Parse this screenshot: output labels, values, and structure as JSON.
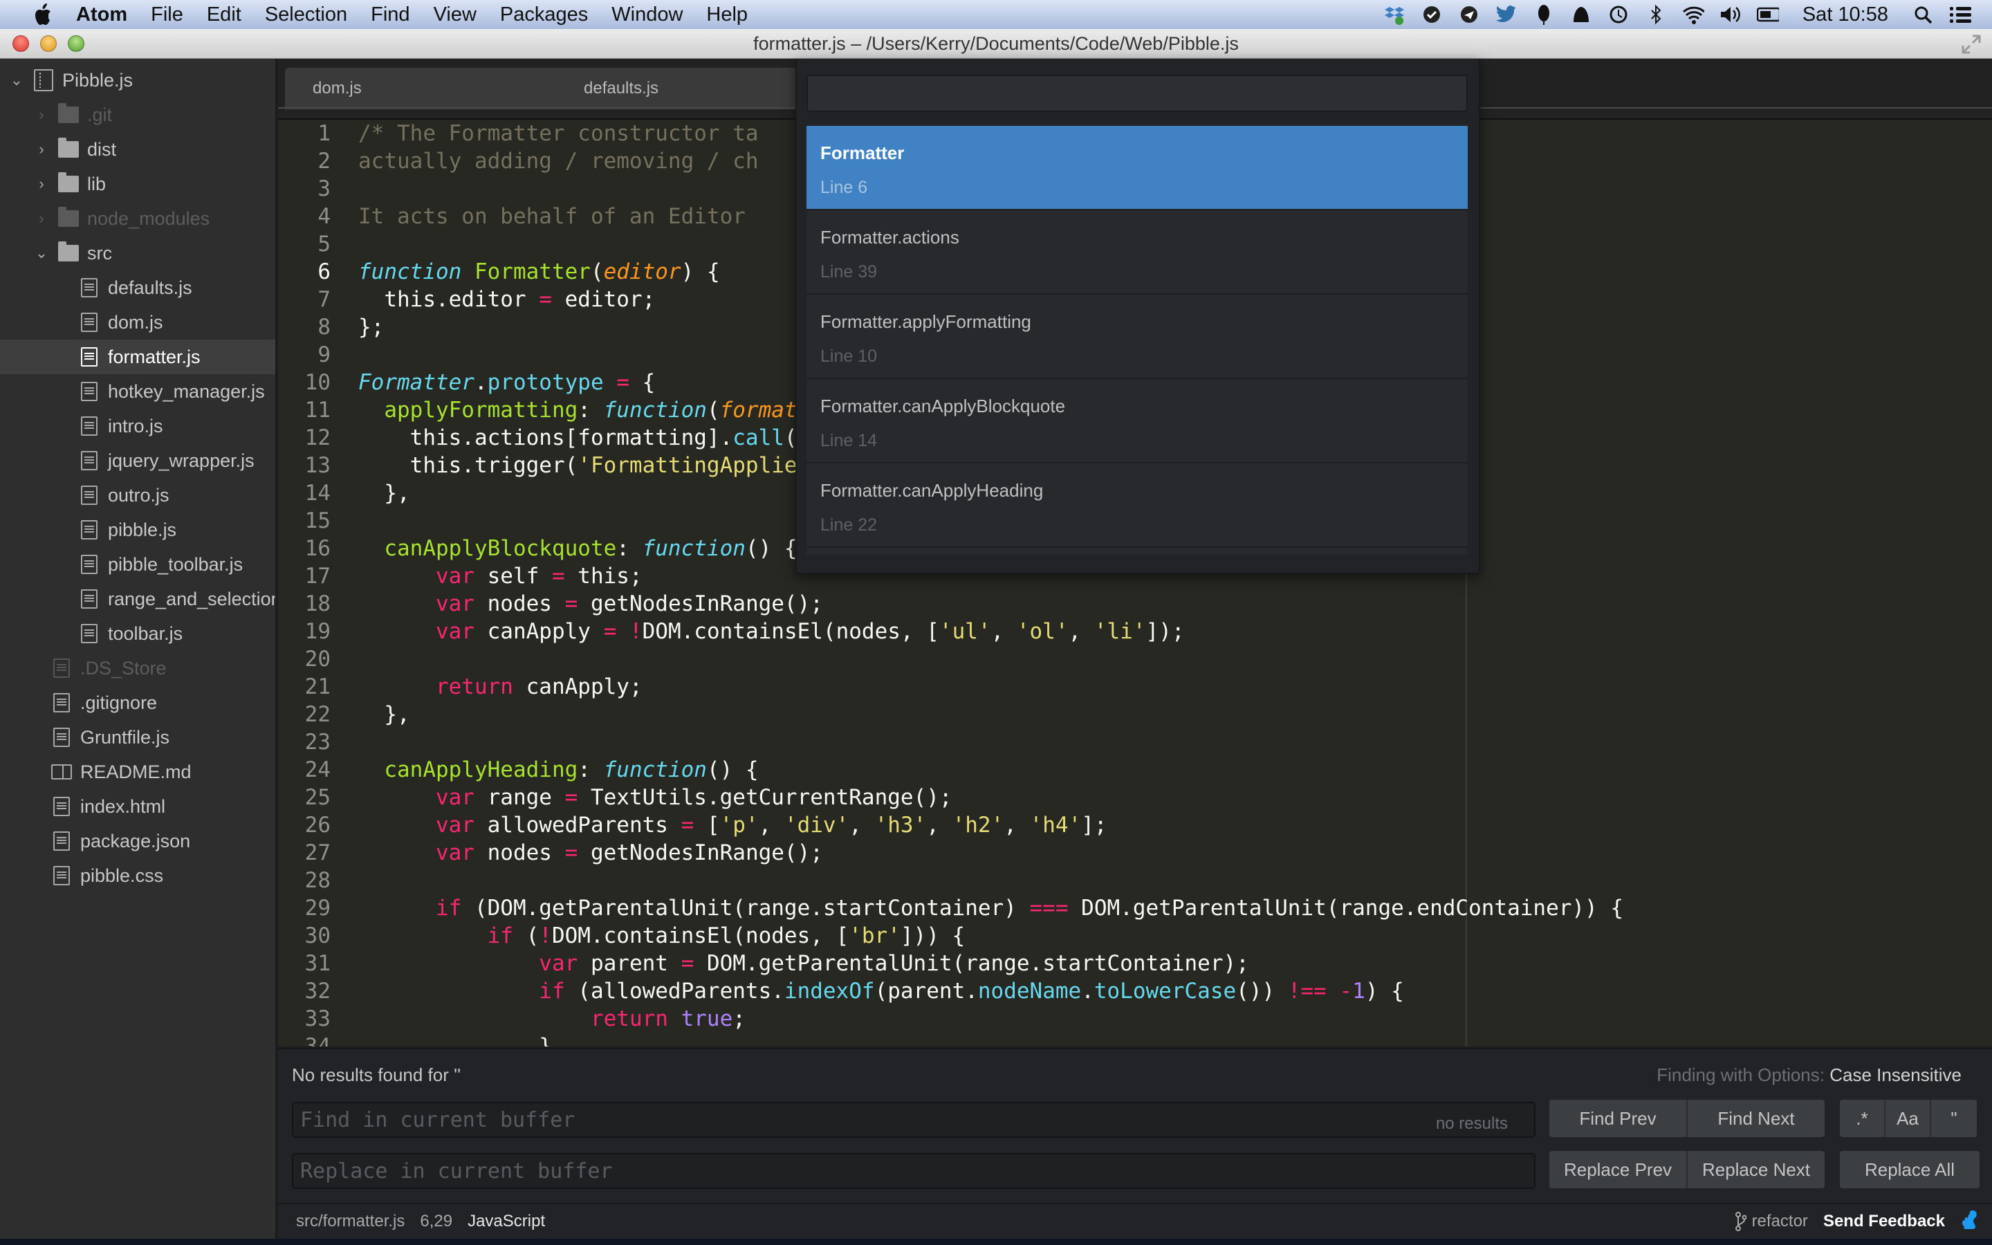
{
  "menubar": {
    "app_name": "Atom",
    "items": [
      "File",
      "Edit",
      "Selection",
      "Find",
      "View",
      "Packages",
      "Window",
      "Help"
    ],
    "tray_icons": [
      "dropbox-icon",
      "skype-icon",
      "airmail-icon",
      "twitter-icon",
      "evernote-icon",
      "growl-icon",
      "time-machine-icon",
      "bluetooth-icon",
      "wifi-icon",
      "volume-icon",
      "battery-icon"
    ],
    "clock": "Sat 10:58"
  },
  "window": {
    "title": "formatter.js – /Users/Kerry/Documents/Code/Web/Pibble.js"
  },
  "tree": {
    "project": "Pibble.js",
    "rows": [
      {
        "label": ".git",
        "type": "folder",
        "depth": 1,
        "expanded": false,
        "ignored": true
      },
      {
        "label": "dist",
        "type": "folder",
        "depth": 1,
        "expanded": false,
        "ignored": false
      },
      {
        "label": "lib",
        "type": "folder",
        "depth": 1,
        "expanded": false,
        "ignored": false
      },
      {
        "label": "node_modules",
        "type": "folder",
        "depth": 1,
        "expanded": false,
        "ignored": true
      },
      {
        "label": "src",
        "type": "folder",
        "depth": 1,
        "expanded": true,
        "ignored": false
      },
      {
        "label": "defaults.js",
        "type": "file",
        "depth": 2
      },
      {
        "label": "dom.js",
        "type": "file",
        "depth": 2
      },
      {
        "label": "formatter.js",
        "type": "file",
        "depth": 2,
        "selected": true
      },
      {
        "label": "hotkey_manager.js",
        "type": "file",
        "depth": 2
      },
      {
        "label": "intro.js",
        "type": "file",
        "depth": 2
      },
      {
        "label": "jquery_wrapper.js",
        "type": "file",
        "depth": 2
      },
      {
        "label": "outro.js",
        "type": "file",
        "depth": 2
      },
      {
        "label": "pibble.js",
        "type": "file",
        "depth": 2
      },
      {
        "label": "pibble_toolbar.js",
        "type": "file",
        "depth": 2
      },
      {
        "label": "range_and_selection",
        "type": "file",
        "depth": 2
      },
      {
        "label": "toolbar.js",
        "type": "file",
        "depth": 2
      },
      {
        "label": ".DS_Store",
        "type": "file",
        "depth": 1,
        "ignored": true
      },
      {
        "label": ".gitignore",
        "type": "file",
        "depth": 1
      },
      {
        "label": "Gruntfile.js",
        "type": "file",
        "depth": 1
      },
      {
        "label": "README.md",
        "type": "readme",
        "depth": 1
      },
      {
        "label": "index.html",
        "type": "file",
        "depth": 1
      },
      {
        "label": "package.json",
        "type": "file",
        "depth": 1
      },
      {
        "label": "pibble.css",
        "type": "file",
        "depth": 1
      }
    ]
  },
  "tabs": [
    {
      "label": "dom.js",
      "close": "×"
    },
    {
      "label": "defaults.js"
    }
  ],
  "editor": {
    "active_line": 6,
    "lines": [
      [
        [
          "cm",
          "/* The Formatter constructor ta"
        ]
      ],
      [
        [
          "cm",
          "actually adding / removing / ch"
        ]
      ],
      [],
      [
        [
          "cm",
          "It acts on behalf of an Editor "
        ]
      ],
      [],
      [
        [
          "sf",
          "function"
        ],
        [
          "",
          " "
        ],
        [
          "fn",
          "Formatter"
        ],
        [
          "",
          "("
        ],
        [
          "ar",
          "editor"
        ],
        [
          "",
          ") {"
        ]
      ],
      [
        [
          "",
          "  this.editor "
        ],
        [
          "kw",
          "="
        ],
        [
          "",
          " editor;"
        ]
      ],
      [
        [
          "",
          "};"
        ]
      ],
      [],
      [
        [
          "sf",
          "Formatter"
        ],
        [
          "",
          "."
        ],
        [
          "sp",
          "prototype"
        ],
        [
          "",
          " "
        ],
        [
          "kw",
          "="
        ],
        [
          "",
          " {"
        ]
      ],
      [
        [
          "",
          "  "
        ],
        [
          "fn",
          "applyFormatting"
        ],
        [
          "",
          ": "
        ],
        [
          "sf",
          "function"
        ],
        [
          "",
          "("
        ],
        [
          "ar",
          "formatting"
        ],
        [
          "",
          ") {"
        ]
      ],
      [
        [
          "",
          "    this.actions[formatting]."
        ],
        [
          "sp",
          "call"
        ],
        [
          "",
          "(this);"
        ]
      ],
      [
        [
          "",
          "    this.trigger("
        ],
        [
          "st",
          "'FormattingApplied'"
        ],
        [
          "",
          ");"
        ]
      ],
      [
        [
          "",
          "  },"
        ]
      ],
      [],
      [
        [
          "",
          "  "
        ],
        [
          "fn",
          "canApplyBlockquote"
        ],
        [
          "",
          ": "
        ],
        [
          "sf",
          "function"
        ],
        [
          "",
          "() {"
        ]
      ],
      [
        [
          "",
          "      "
        ],
        [
          "kw",
          "var"
        ],
        [
          "",
          " self "
        ],
        [
          "kw",
          "="
        ],
        [
          "",
          " this;"
        ]
      ],
      [
        [
          "",
          "      "
        ],
        [
          "kw",
          "var"
        ],
        [
          "",
          " nodes "
        ],
        [
          "kw",
          "="
        ],
        [
          "",
          " getNodesInRange();"
        ]
      ],
      [
        [
          "",
          "      "
        ],
        [
          "kw",
          "var"
        ],
        [
          "",
          " canApply "
        ],
        [
          "kw",
          "="
        ],
        [
          "",
          " "
        ],
        [
          "kw",
          "!"
        ],
        [
          "",
          "DOM.containsEl(nodes, ["
        ],
        [
          "st",
          "'ul'"
        ],
        [
          "",
          ", "
        ],
        [
          "st",
          "'ol'"
        ],
        [
          "",
          ", "
        ],
        [
          "st",
          "'li'"
        ],
        [
          "",
          "]);"
        ]
      ],
      [],
      [
        [
          "",
          "      "
        ],
        [
          "kw",
          "return"
        ],
        [
          "",
          " canApply;"
        ]
      ],
      [
        [
          "",
          "  },"
        ]
      ],
      [],
      [
        [
          "",
          "  "
        ],
        [
          "fn",
          "canApplyHeading"
        ],
        [
          "",
          ": "
        ],
        [
          "sf",
          "function"
        ],
        [
          "",
          "() {"
        ]
      ],
      [
        [
          "",
          "      "
        ],
        [
          "kw",
          "var"
        ],
        [
          "",
          " range "
        ],
        [
          "kw",
          "="
        ],
        [
          "",
          " TextUtils.getCurrentRange();"
        ]
      ],
      [
        [
          "",
          "      "
        ],
        [
          "kw",
          "var"
        ],
        [
          "",
          " allowedParents "
        ],
        [
          "kw",
          "="
        ],
        [
          "",
          " ["
        ],
        [
          "st",
          "'p'"
        ],
        [
          "",
          ", "
        ],
        [
          "st",
          "'div'"
        ],
        [
          "",
          ", "
        ],
        [
          "st",
          "'h3'"
        ],
        [
          "",
          ", "
        ],
        [
          "st",
          "'h2'"
        ],
        [
          "",
          ", "
        ],
        [
          "st",
          "'h4'"
        ],
        [
          "",
          "];"
        ]
      ],
      [
        [
          "",
          "      "
        ],
        [
          "kw",
          "var"
        ],
        [
          "",
          " nodes "
        ],
        [
          "kw",
          "="
        ],
        [
          "",
          " getNodesInRange();"
        ]
      ],
      [],
      [
        [
          "",
          "      "
        ],
        [
          "kw",
          "if"
        ],
        [
          "",
          " (DOM.getParentalUnit(range.startContainer) "
        ],
        [
          "kw",
          "==="
        ],
        [
          "",
          " DOM.getParentalUnit(range.endContainer)) {"
        ]
      ],
      [
        [
          "",
          "          "
        ],
        [
          "kw",
          "if"
        ],
        [
          "",
          " ("
        ],
        [
          "kw",
          "!"
        ],
        [
          "",
          "DOM.containsEl(nodes, ["
        ],
        [
          "st",
          "'br'"
        ],
        [
          "",
          "])) {"
        ]
      ],
      [
        [
          "",
          "              "
        ],
        [
          "kw",
          "var"
        ],
        [
          "",
          " parent "
        ],
        [
          "kw",
          "="
        ],
        [
          "",
          " DOM.getParentalUnit(range.startContainer);"
        ]
      ],
      [
        [
          "",
          "              "
        ],
        [
          "kw",
          "if"
        ],
        [
          "",
          " (allowedParents."
        ],
        [
          "sp",
          "indexOf"
        ],
        [
          "",
          "(parent."
        ],
        [
          "sp",
          "nodeName"
        ],
        [
          "",
          "."
        ],
        [
          "sp",
          "toLowerCase"
        ],
        [
          "",
          "()) "
        ],
        [
          "kw",
          "!=="
        ],
        [
          "",
          " "
        ],
        [
          "kw",
          "-"
        ],
        [
          "nu",
          "1"
        ],
        [
          "",
          ") {"
        ]
      ],
      [
        [
          "",
          "                  "
        ],
        [
          "kw",
          "return"
        ],
        [
          "",
          " "
        ],
        [
          "nu",
          "true"
        ],
        [
          "",
          ";"
        ]
      ],
      [
        [
          "",
          "              }"
        ]
      ]
    ]
  },
  "symbols": {
    "query": "",
    "items": [
      {
        "name": "Formatter",
        "line": "Line 6",
        "selected": true
      },
      {
        "name": "Formatter.actions",
        "line": "Line 39"
      },
      {
        "name": "Formatter.applyFormatting",
        "line": "Line 10"
      },
      {
        "name": "Formatter.canApplyBlockquote",
        "line": "Line 14"
      },
      {
        "name": "Formatter.canApplyHeading",
        "line": "Line 22"
      },
      {
        "name": "",
        "line": ""
      }
    ]
  },
  "find": {
    "message": "No results found for ''",
    "options_label": "Finding with Options:",
    "options_value": "Case Insensitive",
    "find_placeholder": "Find in current buffer",
    "find_value": "",
    "result_count": "no results",
    "replace_placeholder": "Replace in current buffer",
    "replace_value": "",
    "find_prev": "Find Prev",
    "find_next": "Find Next",
    "regex_toggle": ".*",
    "case_toggle": "Aa",
    "whole_word_toggle": "\"",
    "replace_prev": "Replace Prev",
    "replace_next": "Replace Next",
    "replace_all": "Replace All"
  },
  "status": {
    "file_path": "src/formatter.js",
    "cursor": "6,29",
    "grammar": "JavaScript",
    "branch": "refactor",
    "feedback": "Send Feedback"
  },
  "colors": {
    "accent_selection": "#4182c4",
    "editor_bg": "#272822",
    "feedback_icon": "#1d9bf0"
  }
}
